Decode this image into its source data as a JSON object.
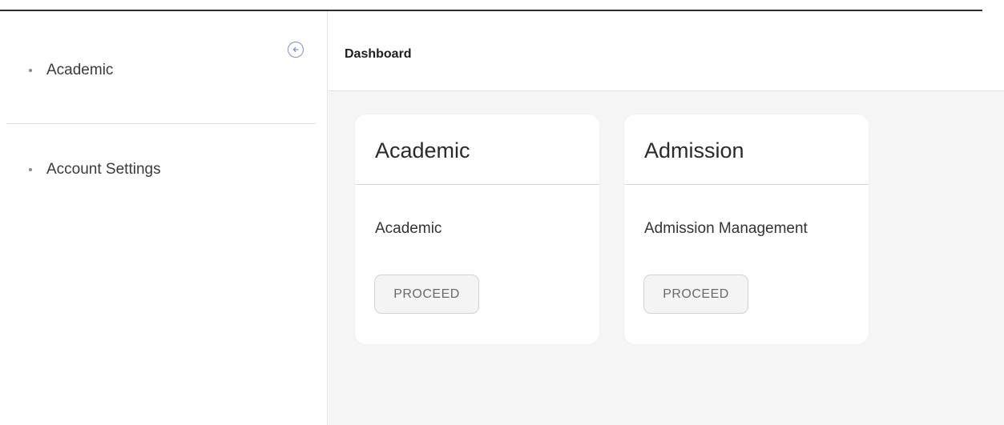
{
  "sidebar": {
    "items": [
      {
        "label": "Academic"
      },
      {
        "label": "Account Settings"
      }
    ],
    "collapse_icon": "arrow-left-circle-icon"
  },
  "header": {
    "title": "Dashboard"
  },
  "cards": [
    {
      "title": "Academic",
      "description": "Academic",
      "button_label": "PROCEED"
    },
    {
      "title": "Admission",
      "description": "Admission Management",
      "button_label": "PROCEED"
    }
  ],
  "colors": {
    "accent_icon": "#8a8fbf",
    "main_background": "#f5f5f5",
    "card_background": "#ffffff"
  }
}
